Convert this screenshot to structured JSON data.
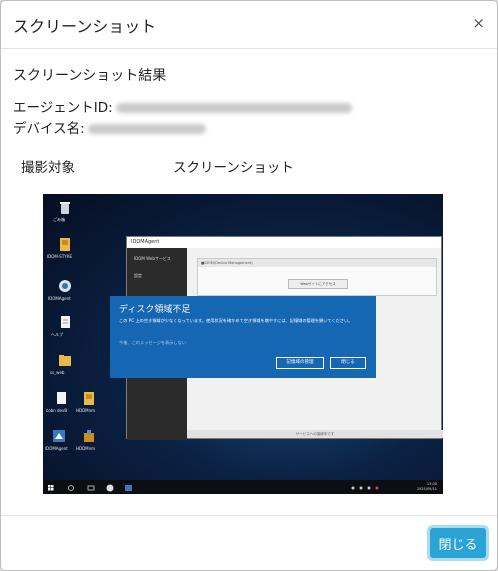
{
  "modal": {
    "title": "スクリーンショット",
    "close_icon": "×"
  },
  "section_title": "スクリーンショット結果",
  "agent_id_label": "エージェントID:",
  "device_name_label": "デバイス名:",
  "target_label": "撮影対象",
  "target_value": "スクリーンショット",
  "screenshot": {
    "desktop_icons": [
      "ごみ箱",
      "IDOM-STYRE",
      "IDOMAgent",
      "ヘルプ",
      "ss_web",
      "cobn devB",
      "HDDMnm",
      "IDOMAgent",
      "HDDMnm"
    ],
    "agent_window": {
      "title": "IDOMAgent",
      "sidebar_items": [
        "IDOM Webサービス",
        "設定"
      ],
      "panel_header": "■IDOM(Device Management)",
      "panel_button": "Webサイトにアクセス",
      "status_text": "サービスへの接続中です"
    },
    "disk_dialog": {
      "title": "ディスク領域不足",
      "message": "この PC 上の空き領域が少なくなっています。使用状況を確かめて空き領域を増やすには、記憶域の管理を開いてください。",
      "dont_show": "今後、このメッセージを表示しない",
      "btn_manage": "記憶域の管理",
      "btn_close": "閉じる"
    },
    "taskbar_clock": {
      "time": "13:00",
      "date": "2025/09/11"
    }
  },
  "footer": {
    "close_button": "閉じる"
  }
}
